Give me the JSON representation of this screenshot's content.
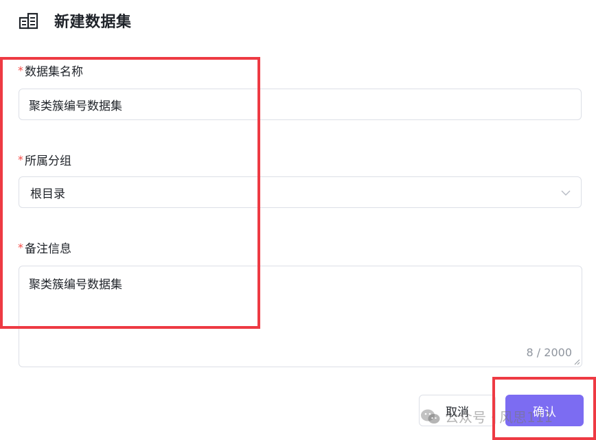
{
  "dialog": {
    "title": "新建数据集",
    "title_icon": "dataset-icon"
  },
  "form": {
    "name": {
      "required_mark": "*",
      "label": "数据集名称",
      "value": "聚类簇编号数据集"
    },
    "group": {
      "required_mark": "*",
      "label": "所属分组",
      "selected": "根目录",
      "arrow_icon": "chevron-down-icon"
    },
    "remark": {
      "required_mark": "*",
      "label": "备注信息",
      "value": "聚类簇编号数据集",
      "counter": "8 / 2000"
    }
  },
  "buttons": {
    "cancel": "取消",
    "confirm": "确认"
  },
  "colors": {
    "accent": "#7c6cf2",
    "required": "#f54a45",
    "annotation": "#ee3a43",
    "border": "#dcdfe6"
  },
  "watermark": {
    "text": "公众号 · 风思111",
    "icon": "wechat-icon"
  }
}
